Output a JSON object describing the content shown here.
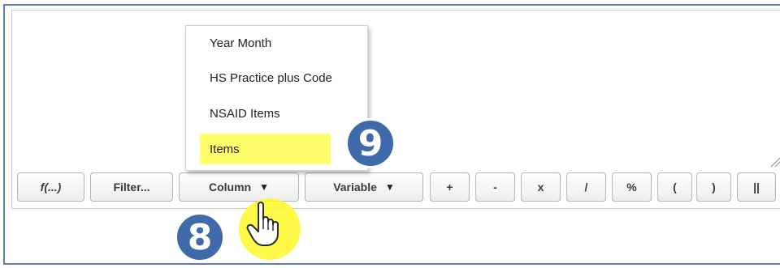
{
  "toolbar": {
    "buttons": [
      {
        "id": "function",
        "label": "f(...)"
      },
      {
        "id": "filter",
        "label": "Filter..."
      },
      {
        "id": "column",
        "label": "Column",
        "arrow": "▼"
      },
      {
        "id": "variable",
        "label": "Variable",
        "arrow": "▼"
      },
      {
        "id": "plus",
        "label": "+"
      },
      {
        "id": "minus",
        "label": "-"
      },
      {
        "id": "multiply",
        "label": "x"
      },
      {
        "id": "divide",
        "label": "/"
      },
      {
        "id": "percent",
        "label": "%"
      },
      {
        "id": "open-paren",
        "label": "("
      },
      {
        "id": "close-paren",
        "label": ")"
      },
      {
        "id": "concat",
        "label": "||"
      }
    ]
  },
  "column_menu": {
    "items": [
      {
        "label": "Year Month"
      },
      {
        "label": "HS Practice plus Code"
      },
      {
        "label": "NSAID Items"
      },
      {
        "label": "Items",
        "highlighted": true
      }
    ]
  },
  "annotations": {
    "step_menu": "9",
    "step_button": "8",
    "badge_color": "#3f6aa9",
    "highlight_color": "#ffff6b"
  },
  "icons": {
    "cursor": "pointing-hand-icon",
    "resize": "resize-grip-icon"
  }
}
